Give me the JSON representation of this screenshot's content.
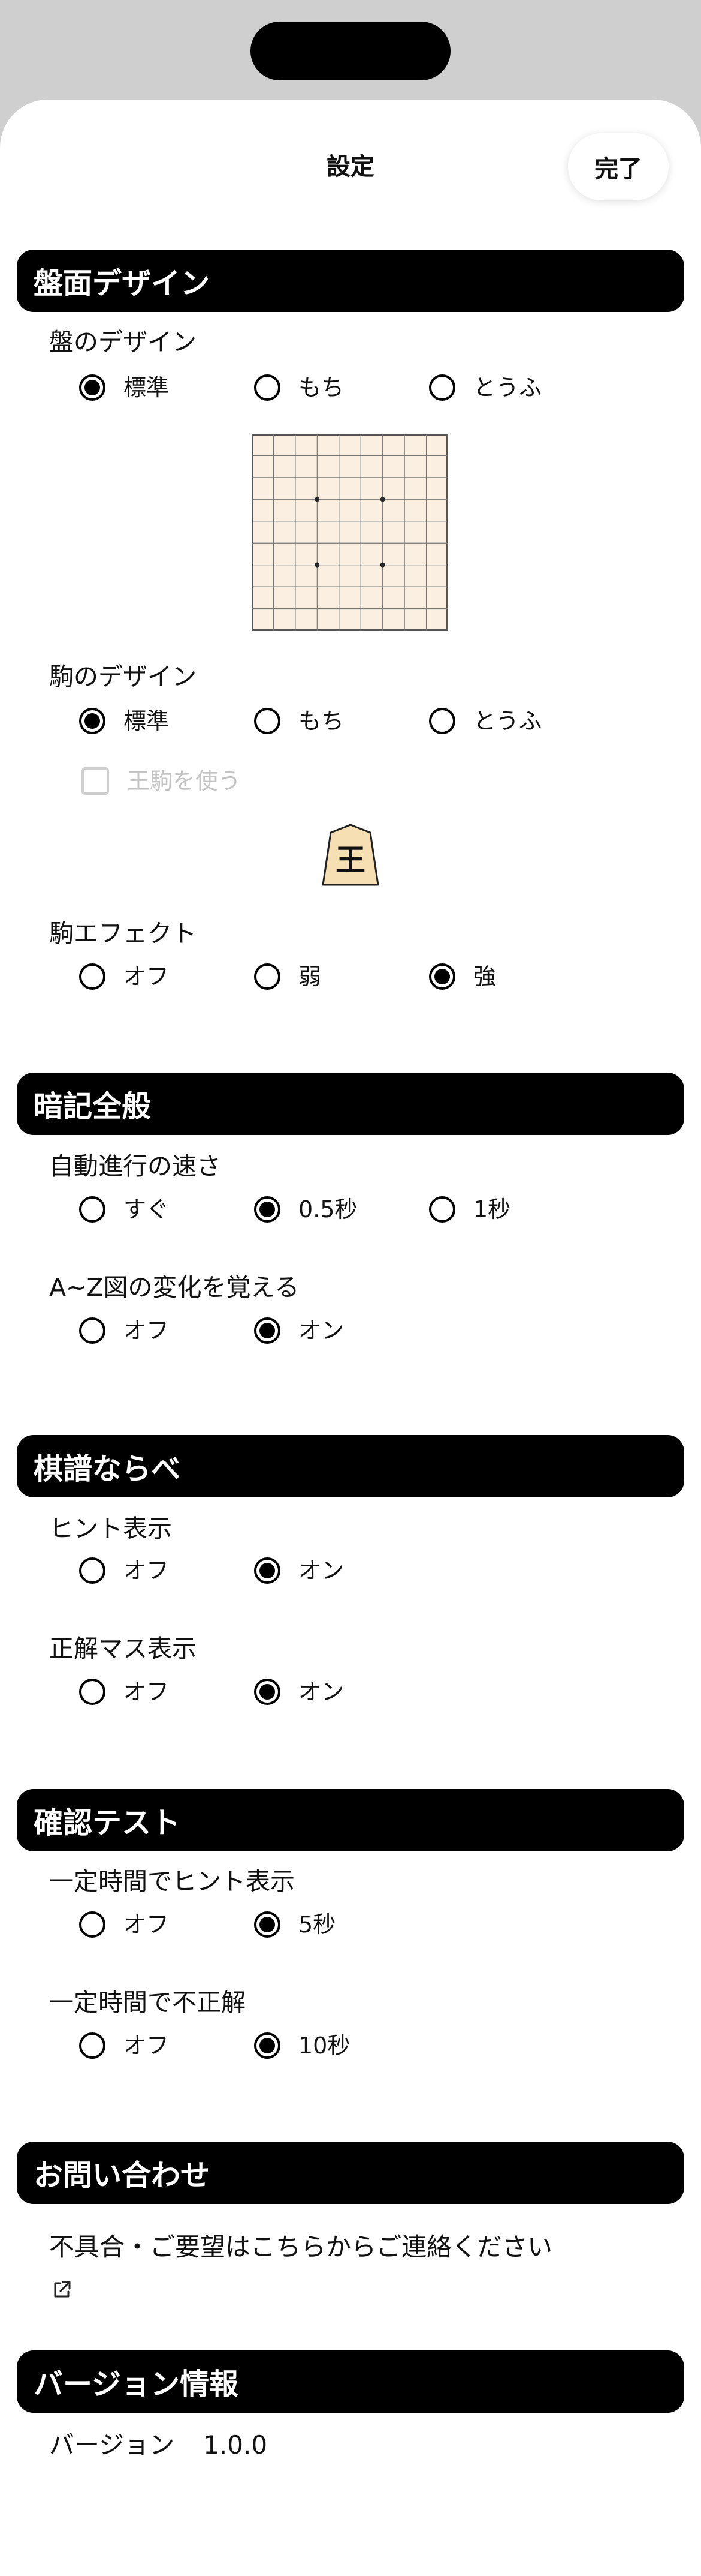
{
  "nav": {
    "title": "設定",
    "done_label": "完了"
  },
  "sections": {
    "board_design": {
      "header": "盤面デザイン",
      "board_label": "盤のデザイン",
      "board_options": [
        "標準",
        "もち",
        "とうふ"
      ],
      "board_selected": "標準",
      "piece_label": "駒のデザイン",
      "piece_options": [
        "標準",
        "もち",
        "とうふ"
      ],
      "piece_selected": "標準",
      "king_checkbox": "王駒を使う",
      "king_checkbox_checked": false,
      "king_checkbox_disabled": true,
      "piece_preview_char": "王",
      "effect_label": "駒エフェクト",
      "effect_options": [
        "オフ",
        "弱",
        "強"
      ],
      "effect_selected": "強"
    },
    "memorize": {
      "header": "暗記全般",
      "speed_label": "自動進行の速さ",
      "speed_options": [
        "すぐ",
        "0.5秒",
        "1秒"
      ],
      "speed_selected": "0.5秒",
      "variation_label": "A~Z図の変化を覚える",
      "variation_options": [
        "オフ",
        "オン"
      ],
      "variation_selected": "オン"
    },
    "kifu": {
      "header": "棋譜ならべ",
      "hint_label": "ヒント表示",
      "hint_options": [
        "オフ",
        "オン"
      ],
      "hint_selected": "オン",
      "answer_label": "正解マス表示",
      "answer_options": [
        "オフ",
        "オン"
      ],
      "answer_selected": "オン"
    },
    "test": {
      "header": "確認テスト",
      "timed_hint_label": "一定時間でヒント表示",
      "timed_hint_options": [
        "オフ",
        "5秒"
      ],
      "timed_hint_selected": "5秒",
      "timed_wrong_label": "一定時間で不正解",
      "timed_wrong_options": [
        "オフ",
        "10秒"
      ],
      "timed_wrong_selected": "10秒"
    },
    "contact": {
      "header": "お問い合わせ",
      "link_text": "不具合・ご要望はこちらからご連絡ください",
      "link_icon": "external-link-icon"
    },
    "version": {
      "header": "バージョン情報",
      "label": "バージョン",
      "value": "1.0.0"
    }
  },
  "colors": {
    "header_bg": "#000000",
    "board_fill": "#fbefe2",
    "piece_fill": "#f6dfb3",
    "disabled_text": "#c4c4c4"
  }
}
